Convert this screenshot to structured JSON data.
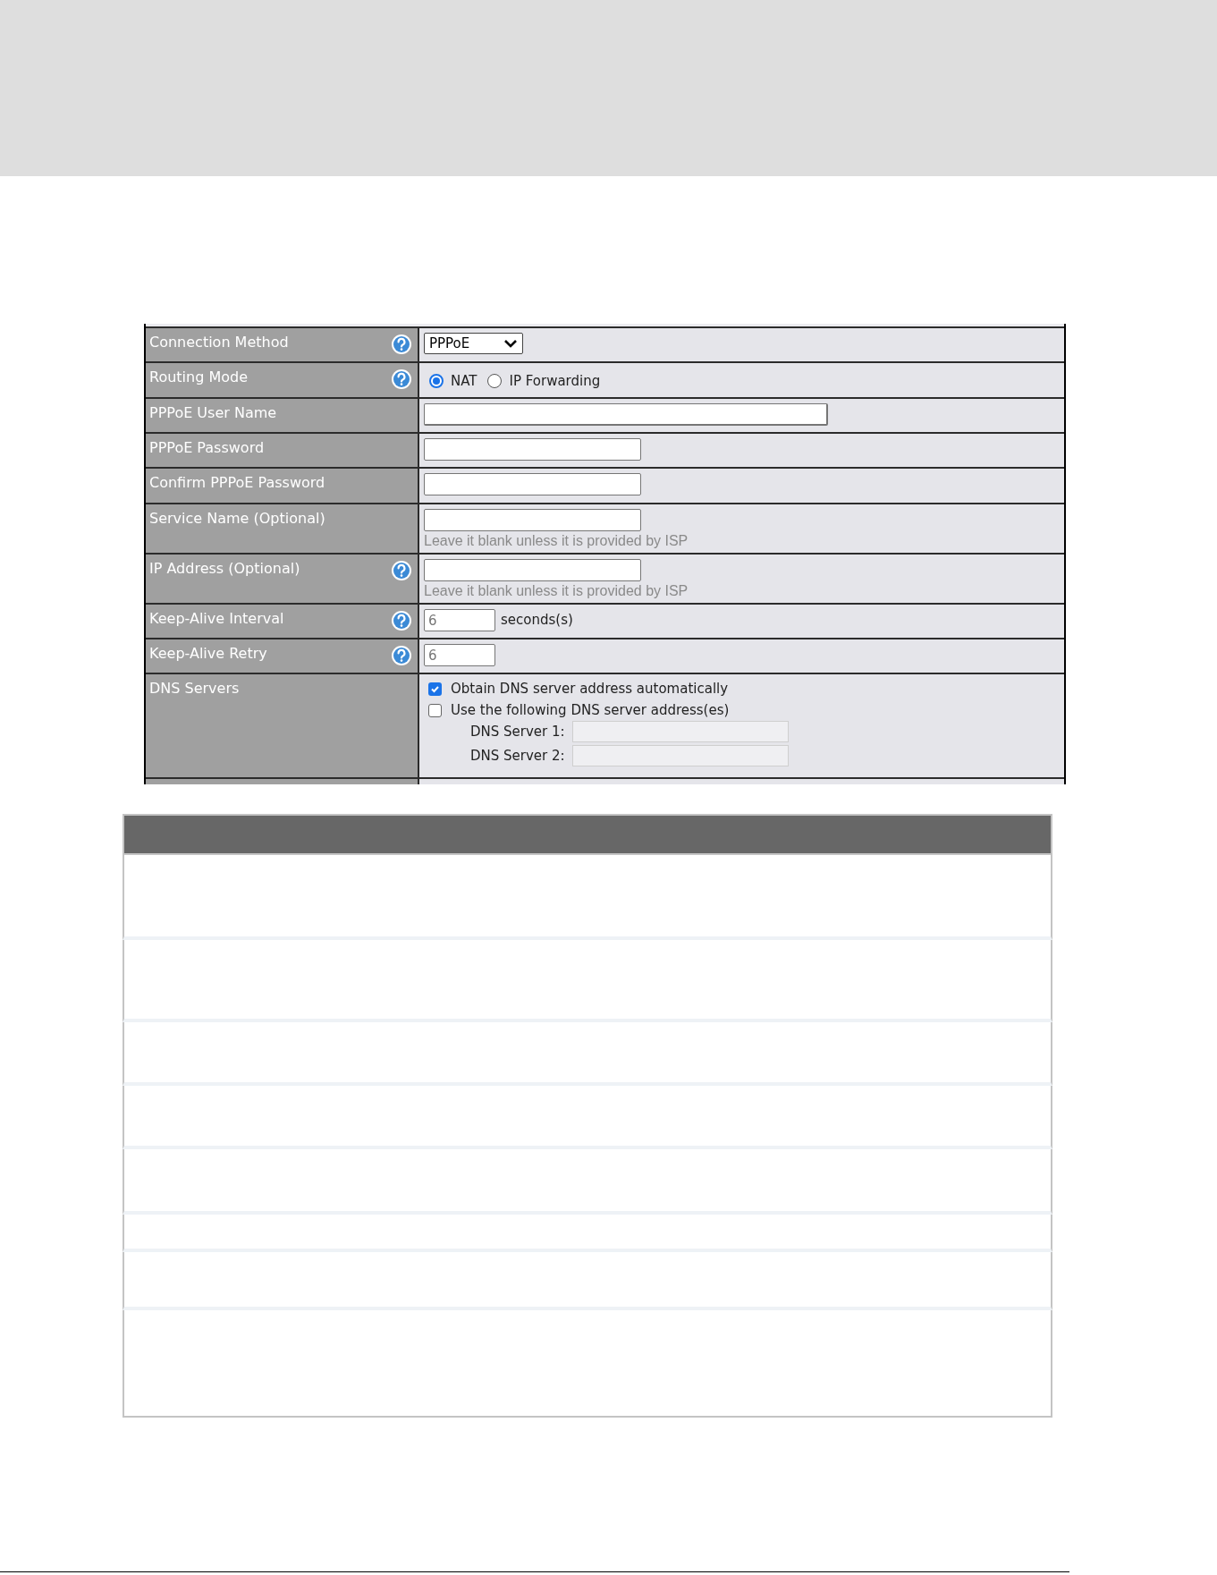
{
  "form": {
    "rows": [
      {
        "label": "Connection Method",
        "help": true,
        "kind": "select",
        "value": "PPPoE"
      },
      {
        "label": "Routing Mode",
        "help": true,
        "kind": "radio",
        "options": [
          {
            "label": "NAT",
            "selected": true
          },
          {
            "label": "IP Forwarding",
            "selected": false
          }
        ]
      },
      {
        "label": "PPPoE User Name",
        "help": false,
        "kind": "text-wide"
      },
      {
        "label": "PPPoE Password",
        "help": false,
        "kind": "text"
      },
      {
        "label": "Confirm PPPoE Password",
        "help": false,
        "kind": "text"
      },
      {
        "label": "Service Name (Optional)",
        "help": false,
        "kind": "text",
        "hint": "Leave it blank unless it is provided by ISP"
      },
      {
        "label": "IP Address (Optional)",
        "help": true,
        "kind": "text",
        "hint": "Leave it blank unless it is provided by ISP"
      },
      {
        "label": "Keep-Alive Interval",
        "help": true,
        "kind": "number",
        "placeholder": "6",
        "unit": "seconds(s)"
      },
      {
        "label": "Keep-Alive Retry",
        "help": true,
        "kind": "number",
        "placeholder": "6"
      },
      {
        "label": "DNS Servers",
        "help": false,
        "kind": "dns",
        "options": [
          {
            "label": "Obtain DNS server address automatically",
            "checked": true
          },
          {
            "label": "Use the following DNS server address(es)",
            "checked": false
          }
        ],
        "servers": [
          {
            "label": "DNS Server 1:",
            "disabled": true
          },
          {
            "label": "DNS Server 2:",
            "disabled": true
          }
        ]
      }
    ]
  },
  "table": {
    "rows": [
      {
        "kind": "blank"
      },
      {
        "kind": "blank"
      },
      {
        "kind": "blank"
      },
      {
        "kind": "blank"
      },
      {
        "kind": "blank"
      },
      {
        "kind": "blank"
      },
      {
        "kind": "blank"
      },
      {
        "kind": "blank"
      }
    ]
  }
}
